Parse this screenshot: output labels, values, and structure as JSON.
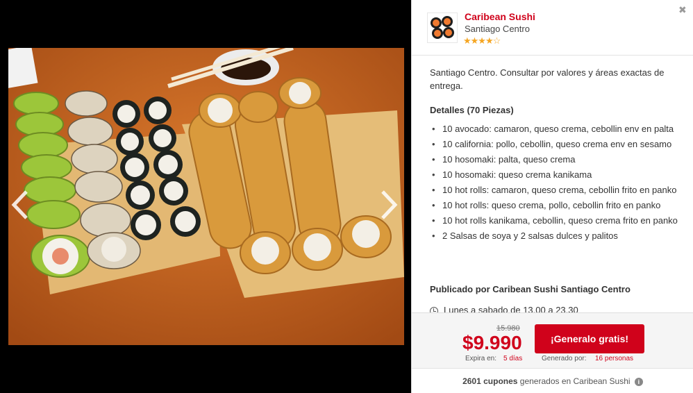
{
  "store": {
    "name": "Caribean Sushi",
    "location": "Santiago Centro",
    "rating_stars": "★★★★☆",
    "close_glyph": "✖"
  },
  "body": {
    "intro": "Santiago Centro. Consultar por valores y áreas exactas de entrega.",
    "details_title": "Detalles (70 Piezas)",
    "details_items": [
      "10 avocado: camaron, queso crema, cebollin env en palta",
      "10 california: pollo, cebollin, queso crema env en sesamo",
      "10 hosomaki: palta, queso crema",
      "10 hosomaki: queso crema kanikama",
      "10 hot rolls: camaron, queso crema, cebollin frito en panko",
      "10 hot rolls: queso crema, pollo, cebollin frito en panko",
      "10 hot rolls kanikama, cebollin, queso crema frito en panko",
      "2 Salsas de soya y 2 salsas dulces y palitos"
    ],
    "publisher_title": "Publicado por Caribean Sushi Santiago Centro",
    "hours": "Lunes a sabado de 13.00 a 23.30"
  },
  "deal": {
    "old_price": "15.980",
    "price": "$9.990",
    "expires_label": "Expira en:",
    "expires_value": "5 días",
    "cta_label": "¡Generalo gratis!",
    "generated_label": "Generado por:",
    "generated_value": "16 personas"
  },
  "footer": {
    "count": "2601 cupones",
    "text": " generados en Caribean Sushi",
    "info_glyph": "i"
  },
  "colors": {
    "brand_red": "#d0021b",
    "star": "#f5a623"
  },
  "icons": {
    "prev": "chevron-left-icon",
    "next": "chevron-right-icon",
    "clock": "clock-icon",
    "info": "info-icon",
    "close": "close-icon"
  }
}
